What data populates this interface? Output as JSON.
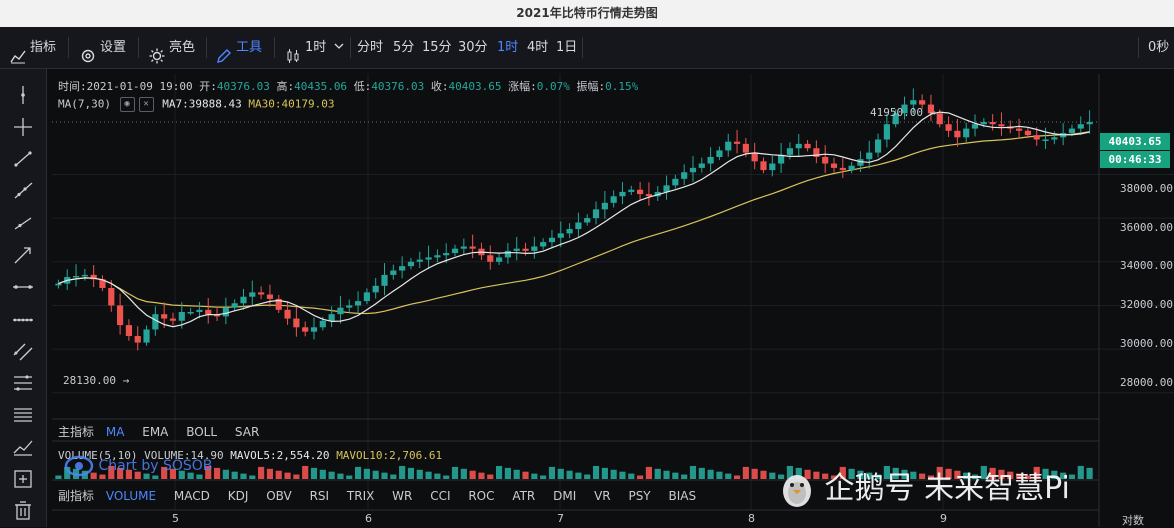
{
  "window": {
    "title": "2021年比特币行情走势图"
  },
  "toolbar": {
    "indicators": "指标",
    "settings": "设置",
    "theme": "亮色",
    "tools": "工具",
    "chart_type": "1时",
    "intervals": [
      "分时",
      "5分",
      "15分",
      "30分",
      "1时",
      "4时",
      "1日"
    ],
    "active_interval": "1时",
    "countdown": "0秒"
  },
  "info_line": {
    "time_label": "时间:",
    "time": "2021-01-09 19:00",
    "open_label": "开:",
    "open": "40376.03",
    "high_label": "高:",
    "high": "40435.06",
    "low_label": "低:",
    "low": "40376.03",
    "close_label": "收:",
    "close": "40403.65",
    "change_label": "涨幅:",
    "change": "0.07%",
    "amp_label": "振幅:",
    "amp": "0.15%"
  },
  "ma_line": {
    "name": "MA(7,30)",
    "ma7": "MA7:39888.43",
    "ma30": "MA30:40179.03"
  },
  "vol_line": {
    "name": "VOLUME(5,10)",
    "vol": "VOLUME:14.90",
    "mavol5": "MAVOL5:2,554.20",
    "mavol10": "MAVOL10:2,706.61"
  },
  "main_tabs": {
    "label": "主指标",
    "items": [
      "MA",
      "EMA",
      "BOLL",
      "SAR"
    ],
    "active": "MA"
  },
  "sub_tabs": {
    "label": "副指标",
    "items": [
      "VOLUME",
      "MACD",
      "KDJ",
      "OBV",
      "RSI",
      "TRIX",
      "WR",
      "CCI",
      "ROC",
      "ATR",
      "DMI",
      "VR",
      "PSY",
      "BIAS"
    ],
    "active": "VOLUME"
  },
  "price_tags": {
    "last": "40403.65",
    "countdown": "00:46:33"
  },
  "footer": {
    "scale": "对数"
  },
  "watermarks": {
    "chart_by": "Chart by SOSOB",
    "publisher": "企鹅号 未来智慧Pi"
  },
  "colors": {
    "up": "#26a69a",
    "down": "#ef5350",
    "ma7": "#e8e8e8",
    "ma30": "#d8c35a",
    "accent": "#4f86ff",
    "price_tag": "#17a37f",
    "bg": "#0d0e10"
  },
  "chart_data": {
    "type": "candlestick",
    "title": "2021年比特币行情走势图",
    "interval": "1h",
    "y_ticks": [
      "28000.00",
      "30000.00",
      "32000.00",
      "34000.00",
      "36000.00",
      "38000.00"
    ],
    "y_tick_values": [
      28000,
      30000,
      32000,
      34000,
      36000,
      38000
    ],
    "ylim": [
      26800,
      42600
    ],
    "x_ticks": [
      "5",
      "6",
      "7",
      "8",
      "9"
    ],
    "annotations": {
      "max_label": "41950.00",
      "max": 41950,
      "min_label": "28130.00",
      "min": 28130
    },
    "last_price": 40403.65,
    "close_series": [
      33000,
      33300,
      33350,
      33400,
      33200,
      32800,
      32000,
      31100,
      30600,
      30300,
      30900,
      31600,
      31400,
      31300,
      31700,
      31700,
      31800,
      31600,
      31500,
      31900,
      32100,
      32400,
      32600,
      32500,
      32300,
      31800,
      31400,
      31000,
      30800,
      31000,
      31300,
      31600,
      31900,
      32000,
      32200,
      32600,
      32900,
      33400,
      33600,
      33800,
      34000,
      34100,
      34200,
      34300,
      34400,
      34600,
      34700,
      34600,
      34300,
      34000,
      34200,
      34500,
      34600,
      34500,
      34700,
      34900,
      35100,
      35300,
      35500,
      35800,
      36000,
      36400,
      36700,
      37000,
      37200,
      37300,
      37100,
      37000,
      37200,
      37500,
      37800,
      38100,
      38300,
      38500,
      38800,
      39100,
      39500,
      39400,
      39000,
      38600,
      38200,
      38500,
      38900,
      39200,
      39400,
      39200,
      38800,
      38500,
      38300,
      38200,
      38400,
      38700,
      39000,
      39600,
      40300,
      40800,
      41200,
      41400,
      41200,
      40800,
      40300,
      40000,
      39700,
      40100,
      40300,
      40400,
      40300,
      40200,
      40100,
      40000,
      39800,
      39600,
      39600,
      39700,
      39900,
      40100,
      40300,
      40400
    ],
    "volume_max": 9000
  }
}
